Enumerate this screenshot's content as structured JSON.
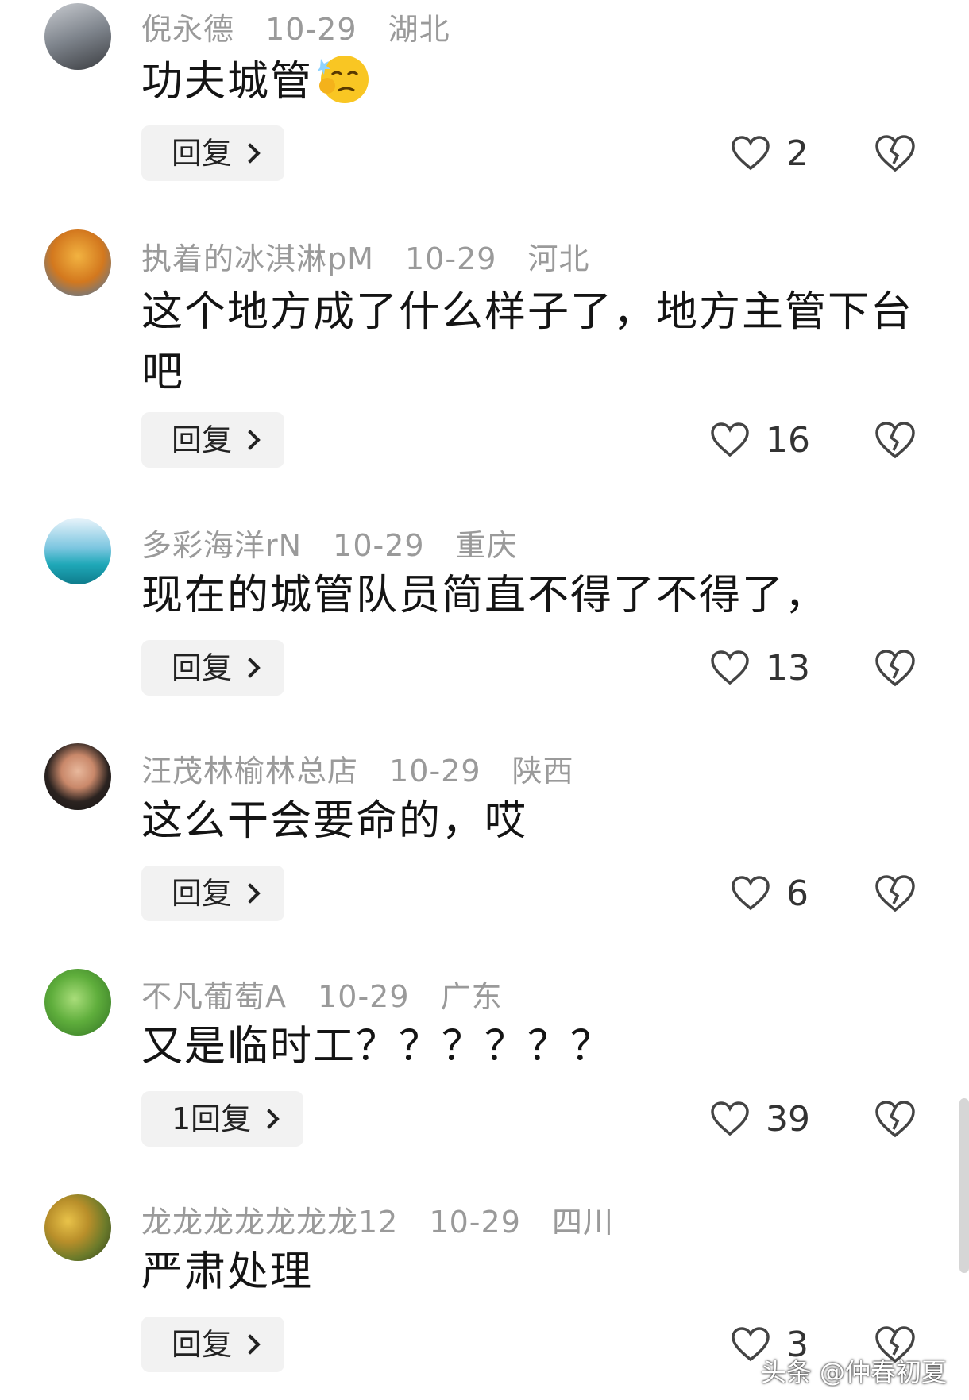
{
  "comments": [
    {
      "user": "倪永德",
      "date": "10-29",
      "location": "湖北",
      "text": "功夫城管",
      "reply": "回复",
      "likes": "2",
      "avatar_color": "#8a8f96"
    },
    {
      "user": "执着的冰淇淋pM",
      "date": "10-29",
      "location": "河北",
      "text": "这个地方成了什么样子了，地方主管下台吧",
      "reply": "回复",
      "likes": "16",
      "avatar_color": "#d08a2a"
    },
    {
      "user": "多彩海洋rN",
      "date": "10-29",
      "location": "重庆",
      "text": "现在的城管队员简直不得了不得了，",
      "reply": "回复",
      "likes": "13",
      "avatar_color": "#5bb6c9"
    },
    {
      "user": "汪茂林榆林总店",
      "date": "10-29",
      "location": "陕西",
      "text": "这么干会要命的，哎",
      "reply": "回复",
      "likes": "6",
      "avatar_color": "#6b4a3a"
    },
    {
      "user": "不凡葡萄A",
      "date": "10-29",
      "location": "广东",
      "text": "又是临时工？？？？？？",
      "reply": "1回复",
      "likes": "39",
      "avatar_color": "#4f9a3b"
    },
    {
      "user": "龙龙龙龙龙龙龙12",
      "date": "10-29",
      "location": "四川",
      "text": "严肃处理",
      "reply": "回复",
      "likes": "3",
      "avatar_color": "#9a8a3b"
    }
  ],
  "watermark": "头条 @仲春初夏",
  "icons": {
    "like": "heart-outline-icon",
    "dislike": "broken-heart-icon",
    "reply_arrow": "chevron-right-icon",
    "emoji": "thinking-smug-emoji"
  }
}
